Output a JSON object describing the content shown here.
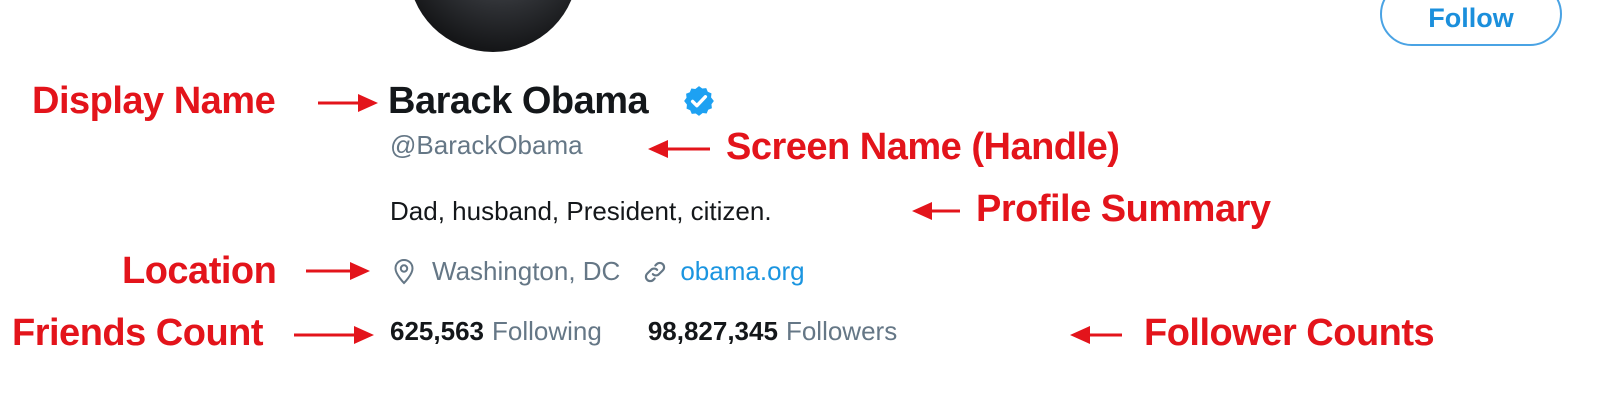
{
  "profile": {
    "display_name": "Barack Obama",
    "handle": "@BarackObama",
    "bio": "Dad, husband, President, citizen.",
    "location": "Washington, DC",
    "website": "obama.org",
    "following_count": "625,563",
    "following_label": "Following",
    "followers_count": "98,827,345",
    "followers_label": "Followers",
    "verified": true
  },
  "follow_button": {
    "label": "Follow"
  },
  "annotations": {
    "display_name": "Display Name",
    "screen_name": "Screen Name (Handle)",
    "profile_summary": "Profile Summary",
    "location": "Location",
    "friends_count": "Friends Count",
    "follower_counts": "Follower Counts"
  },
  "colors": {
    "annotation": "#e3141b",
    "link": "#1b95e0",
    "verified_badge": "#1da1f2",
    "secondary_text": "#657786"
  },
  "icons": [
    "verified-badge-icon",
    "location-pin-icon",
    "link-icon"
  ]
}
